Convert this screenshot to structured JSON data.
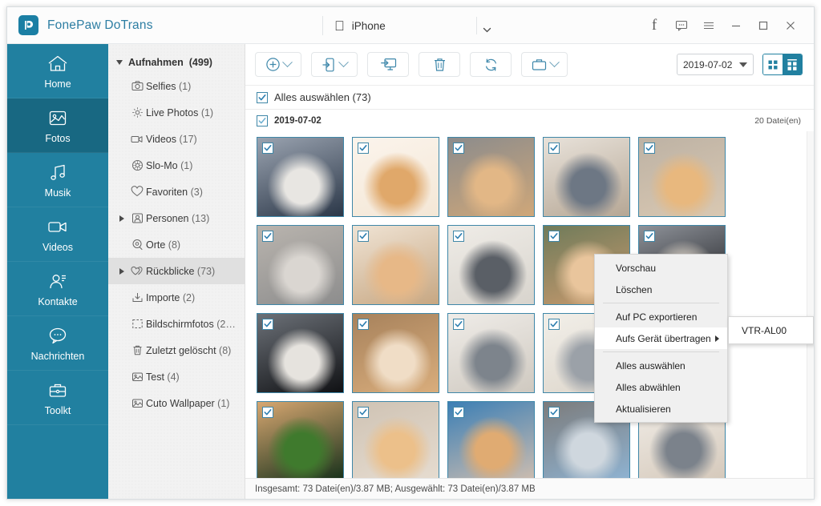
{
  "titlebar": {
    "brand": "FonePaw DoTrans",
    "logo_icon": "fonepaw-logo-icon",
    "apple_icon": "apple-logo-icon",
    "device": "iPhone",
    "device_caret_icon": "chevron-down-icon",
    "actions": [
      {
        "name": "facebook-icon",
        "glyph": "f"
      },
      {
        "name": "feedback-icon",
        "glyph": ""
      },
      {
        "name": "menu-icon",
        "glyph": ""
      },
      {
        "name": "minimize-icon",
        "glyph": ""
      },
      {
        "name": "maximize-icon",
        "glyph": ""
      },
      {
        "name": "close-icon",
        "glyph": ""
      }
    ]
  },
  "sidebar": {
    "items": [
      {
        "label": "Home",
        "icon": "home-icon",
        "active": false
      },
      {
        "label": "Fotos",
        "icon": "photos-icon",
        "active": true
      },
      {
        "label": "Musik",
        "icon": "music-icon",
        "active": false
      },
      {
        "label": "Videos",
        "icon": "video-icon",
        "active": false
      },
      {
        "label": "Kontakte",
        "icon": "contacts-icon",
        "active": false
      },
      {
        "label": "Nachrichten",
        "icon": "messages-icon",
        "active": false
      },
      {
        "label": "Toolkt",
        "icon": "toolkit-icon",
        "active": false
      }
    ]
  },
  "tree": {
    "root": {
      "label": "Aufnahmen",
      "count": "(499)",
      "expander": "down"
    },
    "items": [
      {
        "label": "Selfies",
        "count": "(1)",
        "icon": "camera-icon",
        "expander": "none",
        "selected": false
      },
      {
        "label": "Live Photos",
        "count": "(1)",
        "icon": "live-photo-icon",
        "expander": "none",
        "selected": false
      },
      {
        "label": "Videos",
        "count": "(17)",
        "icon": "video-icon",
        "expander": "none",
        "selected": false
      },
      {
        "label": "Slo-Mo",
        "count": "(1)",
        "icon": "slomo-icon",
        "expander": "none",
        "selected": false
      },
      {
        "label": "Favoriten",
        "count": "(3)",
        "icon": "heart-icon",
        "expander": "none",
        "selected": false
      },
      {
        "label": "Personen",
        "count": "(13)",
        "icon": "people-icon",
        "expander": "right",
        "selected": false
      },
      {
        "label": "Orte",
        "count": "(8)",
        "icon": "places-icon",
        "expander": "none",
        "selected": false
      },
      {
        "label": "Rückblicke",
        "count": "(73)",
        "icon": "memories-icon",
        "expander": "right",
        "selected": true
      },
      {
        "label": "Importe",
        "count": "(2)",
        "icon": "import-icon",
        "expander": "none",
        "selected": false
      },
      {
        "label": "Bildschirmfotos",
        "count": "(2…",
        "icon": "screenshot-icon",
        "expander": "none",
        "selected": false
      },
      {
        "label": "Zuletzt gelöscht",
        "count": "(8)",
        "icon": "trash-icon",
        "expander": "none",
        "selected": false
      },
      {
        "label": "Test",
        "count": "(4)",
        "icon": "album-icon",
        "expander": "none",
        "selected": false
      },
      {
        "label": "Cuto Wallpaper",
        "count": "(1)",
        "icon": "album-icon",
        "expander": "none",
        "selected": false
      }
    ]
  },
  "toolbar": {
    "buttons": [
      {
        "name": "add-button",
        "icon": "plus-circle-icon",
        "caret": true
      },
      {
        "name": "export-to-device-button",
        "icon": "phone-export-icon",
        "caret": true
      },
      {
        "name": "export-to-pc-button",
        "icon": "monitor-export-icon",
        "caret": false
      },
      {
        "name": "delete-button",
        "icon": "trash-icon",
        "caret": false
      },
      {
        "name": "refresh-button",
        "icon": "refresh-icon",
        "caret": false
      },
      {
        "name": "toolbox-button",
        "icon": "toolbox-icon",
        "caret": true
      }
    ],
    "date_filter": "2019-07-02",
    "view_grid_icon": "grid-view-icon",
    "view_group_icon": "grouped-grid-view-icon",
    "active_view": "grouped-grid-view-icon"
  },
  "content": {
    "select_all_label": "Alles auswählen (73)",
    "group_title": "2019-07-02",
    "group_count": "20 Datei(en)",
    "thumbnails": [
      {
        "alt": "grey-white-cat-on-checkered-blanket",
        "c1": "#2b3748",
        "c2": "#e8e6e2",
        "c3": "#9aa3b0",
        "selected": true
      },
      {
        "alt": "shiba-lying-on-cream-sofa",
        "c1": "#f4e7d6",
        "c2": "#e0a86a",
        "c3": "#fbf4ec",
        "selected": true
      },
      {
        "alt": "shiba-smiling-by-fence",
        "c1": "#cfa779",
        "c2": "#e2b786",
        "c3": "#8c8c8c",
        "selected": true
      },
      {
        "alt": "grey-white-kitten-standing",
        "c1": "#b6a795",
        "c2": "#6d7784",
        "c3": "#e8e2da",
        "selected": true
      },
      {
        "alt": "shiba-puppy-sitting-indoors",
        "c1": "#d9c8b2",
        "c2": "#e8b87e",
        "c3": "#bdb2a4",
        "selected": true
      },
      {
        "alt": "grey-white-cat-closeup",
        "c1": "#8d8d8d",
        "c2": "#dad6d1",
        "c3": "#b9b4ae",
        "selected": true
      },
      {
        "alt": "shiba-head-side-profile",
        "c1": "#c7a782",
        "c2": "#e7b887",
        "c3": "#efe3d4",
        "selected": true
      },
      {
        "alt": "cat-on-striped-fabric",
        "c1": "#d8d4cd",
        "c2": "#5a5f66",
        "c3": "#efece7",
        "selected": true
      },
      {
        "alt": "dog-licking-nose",
        "c1": "#c99a6e",
        "c2": "#e9c59c",
        "c3": "#6f7b5a",
        "selected": true
      },
      {
        "alt": "grey-white-cat-dark-background",
        "c1": "#15161a",
        "c2": "#cdc6bd",
        "c3": "#8e9299",
        "selected": true
      },
      {
        "alt": "white-kitten-on-dark-step",
        "c1": "#101114",
        "c2": "#e6e3de",
        "c3": "#6c7178",
        "selected": true
      },
      {
        "alt": "shiba-face-closeup-smiling",
        "c1": "#d9ad7c",
        "c2": "#f0ddc6",
        "c3": "#a7825c",
        "selected": true
      },
      {
        "alt": "grey-white-cat-on-blanket",
        "c1": "#cfc9c0",
        "c2": "#7d848c",
        "c3": "#efece8",
        "selected": true
      },
      {
        "alt": "cat-sitting-light-room",
        "c1": "#ddd6cb",
        "c2": "#9ba1a8",
        "c3": "#f2efe9",
        "selected": true
      },
      {
        "alt": "tuxedo-cat-sitting",
        "c1": "#d4c4b0",
        "c2": "#2d2d2d",
        "c3": "#e9e0d3",
        "selected": true
      },
      {
        "alt": "shiba-in-front-of-grass",
        "c1": "#16301a",
        "c2": "#3f7a2d",
        "c3": "#d7a771",
        "selected": true
      },
      {
        "alt": "shiba-puppy-on-stool",
        "c1": "#e6dcd0",
        "c2": "#ecc08a",
        "c3": "#cfc3b4",
        "selected": true
      },
      {
        "alt": "shiba-with-blue-collar",
        "c1": "#cdbdb0",
        "c2": "#e0ab72",
        "c3": "#3c7fb5",
        "selected": true
      },
      {
        "alt": "kitten-in-blue-crate",
        "c1": "#8fb3d2",
        "c2": "#cfd7de",
        "c3": "#7c7c7c",
        "selected": true
      },
      {
        "alt": "grey-white-kitten-portrait",
        "c1": "#d5c9bb",
        "c2": "#7b828b",
        "c3": "#f0ece6",
        "selected": true
      }
    ]
  },
  "context_menu": {
    "items": [
      {
        "label": "Vorschau",
        "hover": false,
        "submenu": false,
        "sep_after": false
      },
      {
        "label": "Löschen",
        "hover": false,
        "submenu": false,
        "sep_after": true
      },
      {
        "label": "Auf PC exportieren",
        "hover": false,
        "submenu": false,
        "sep_after": false
      },
      {
        "label": "Aufs Gerät übertragen",
        "hover": true,
        "submenu": true,
        "sep_after": true
      },
      {
        "label": "Alles auswählen",
        "hover": false,
        "submenu": false,
        "sep_after": false
      },
      {
        "label": "Alles abwählen",
        "hover": false,
        "submenu": false,
        "sep_after": false
      },
      {
        "label": "Aktualisieren",
        "hover": false,
        "submenu": false,
        "sep_after": false
      }
    ],
    "submenu_item": "VTR-AL00"
  },
  "statusbar": {
    "text": "Insgesamt: 73 Datei(en)/3.87 MB; Ausgewählt: 73 Datei(en)/3.87 MB"
  },
  "colors": {
    "brand_teal": "#2180a0",
    "brand_teal_dark": "#186882",
    "accent_blue": "#3f87a8",
    "panel_gray": "#f2f2f2"
  }
}
